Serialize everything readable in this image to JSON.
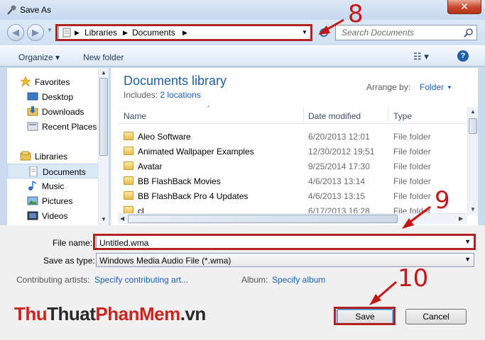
{
  "window": {
    "title": "Save As",
    "close_label": "✕"
  },
  "nav": {
    "back_icon": "◀",
    "forward_icon": "▶",
    "breadcrumb": [
      "Libraries",
      "Documents"
    ],
    "search_placeholder": "Search Documents"
  },
  "toolbar": {
    "organize": "Organize ▾",
    "new_folder": "New folder",
    "help": "?"
  },
  "sidebar": {
    "favorites_label": "Favorites",
    "favorites": [
      "Desktop",
      "Downloads",
      "Recent Places"
    ],
    "libraries_label": "Libraries",
    "libraries": [
      "Documents",
      "Music",
      "Pictures",
      "Videos"
    ]
  },
  "content": {
    "title": "Documents library",
    "includes_label": "Includes:",
    "includes_link": "2 locations",
    "arrange_label": "Arrange by:",
    "arrange_value": "Folder",
    "columns": {
      "name": "Name",
      "date": "Date modified",
      "type": "Type"
    },
    "rows": [
      {
        "name": "Aleo Software",
        "date": "6/20/2013 12:01",
        "type": "File folder"
      },
      {
        "name": "Animated Wallpaper Examples",
        "date": "12/30/2012 19:51",
        "type": "File folder"
      },
      {
        "name": "Avatar",
        "date": "9/25/2014 17:30",
        "type": "File folder"
      },
      {
        "name": "BB FlashBack Movies",
        "date": "4/6/2013 13:14",
        "type": "File folder"
      },
      {
        "name": "BB FlashBack Pro 4 Updates",
        "date": "4/6/2013 13:15",
        "type": "File folder"
      },
      {
        "name": "cl",
        "date": "6/17/2013 16:28",
        "type": "File folder"
      }
    ]
  },
  "form": {
    "filename_label": "File name:",
    "filename_value": "Untitled.wma",
    "savetype_label": "Save as type:",
    "savetype_value": "Windows Media Audio File (*.wma)",
    "artists_label": "Contributing artists:",
    "artists_link": "Specify contributing art...",
    "album_label": "Album:",
    "album_link": "Specify album",
    "save_button": "Save",
    "cancel_button": "Cancel"
  },
  "annotations": {
    "step8": "8",
    "step9": "9",
    "step10": "10"
  },
  "watermark": {
    "part1": "Thu",
    "part2": "Thuat",
    "part3": "PhanMem",
    "part4": ".vn"
  },
  "colors": {
    "annotation_red": "#b22222",
    "link_blue": "#1c5fb4",
    "library_title": "#1e5e9c"
  }
}
